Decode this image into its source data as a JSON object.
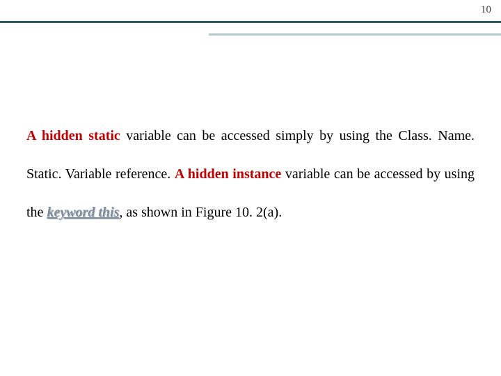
{
  "page_number": "10",
  "p1": "A hidden static",
  "p2": " variable can be accessed simply by using the Class. Name. Static. Variable reference. ",
  "p3": "A hidden instance",
  "p4": " variable can be accessed by using the ",
  "kw1": "keyword ",
  "kw2": "this",
  "p5": ", as shown in Figure 10. 2(a)."
}
